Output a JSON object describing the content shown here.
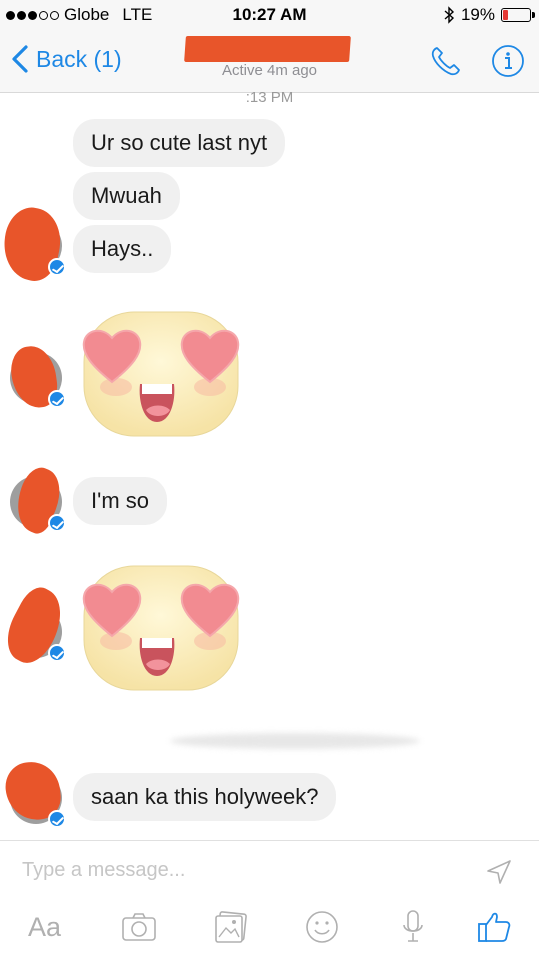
{
  "status_bar": {
    "carrier": "Globe",
    "network": "LTE",
    "time": "10:27 AM",
    "battery": "19%",
    "battery_level": 0.19,
    "battery_color": "#e53935"
  },
  "nav": {
    "back_label": "Back (1)",
    "subtitle": "Active 4m ago",
    "icons": [
      "chevron-left-icon",
      "phone-icon",
      "info-icon"
    ],
    "accent": "#1e88e5"
  },
  "conversation": {
    "timestamp": ":13 PM",
    "messages": [
      {
        "type": "text",
        "text": "Ur so cute last nyt"
      },
      {
        "type": "text",
        "text": "Mwuah"
      },
      {
        "type": "text",
        "text": "Hays.."
      },
      {
        "type": "sticker",
        "sticker": "heart-eyes-sticker"
      },
      {
        "type": "text",
        "text": "I'm so"
      },
      {
        "type": "sticker",
        "sticker": "heart-eyes-sticker"
      },
      {
        "type": "text",
        "text": "saan ka this holyweek?"
      }
    ]
  },
  "composer": {
    "placeholder": "Type a message...",
    "aa_label": "Aa",
    "tools": [
      "text-format-icon",
      "camera-icon",
      "gallery-icon",
      "emoji-icon",
      "microphone-icon",
      "like-icon"
    ],
    "redaction_color": "#e8552a"
  }
}
